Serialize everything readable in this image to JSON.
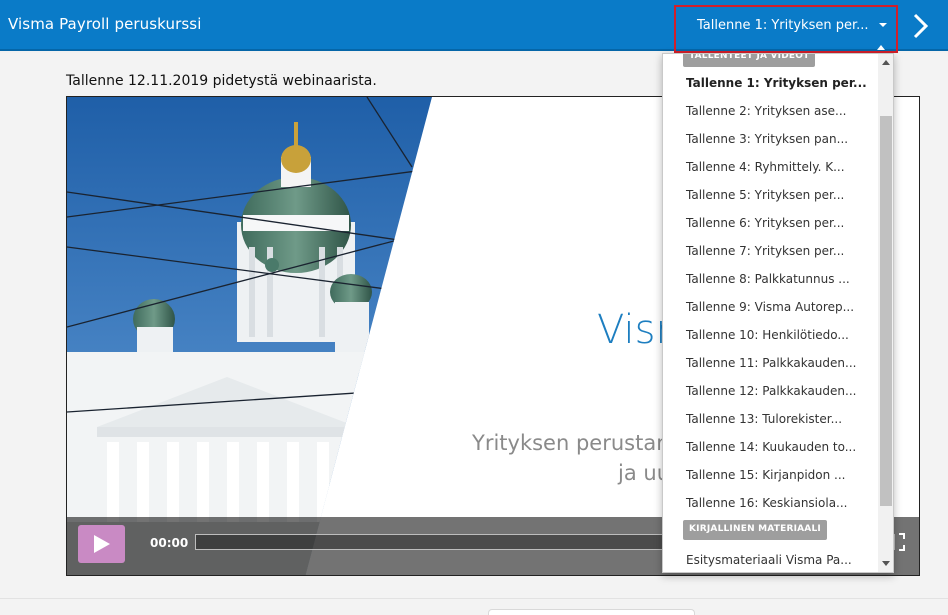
{
  "header": {
    "course_title": "Visma Payroll peruskurssi",
    "selected_recording": "Tallenne 1: Yrityksen per...",
    "next_icon": "chevron-right-icon",
    "bar_color": "#0a7bc8",
    "highlight_color": "#d21f2a"
  },
  "main": {
    "caption": "Tallenne 12.11.2019 pidetystä webinaarista.",
    "slide": {
      "title": "Visma",
      "subtitle_line1": "Yrityksen perustamin",
      "subtitle_line2": "ja uu"
    },
    "player": {
      "play_icon": "play-icon",
      "time": "00:00",
      "fullscreen_icon": "fullscreen-icon",
      "play_color": "#c98ac4"
    }
  },
  "dropdown": {
    "group1_label": "TALLENTEET JA VIDEOT",
    "items": [
      "Tallenne 1: Yrityksen per...",
      "Tallenne 2: Yrityksen ase...",
      "Tallenne 3: Yrityksen pan...",
      "Tallenne 4: Ryhmittely. K...",
      "Tallenne 5: Yrityksen per...",
      "Tallenne 6: Yrityksen per...",
      "Tallenne 7: Yrityksen per...",
      "Tallenne 8: Palkkatunnus ...",
      "Tallenne 9: Visma Autorep...",
      "Tallenne 10: Henkilötiedo...",
      "Tallenne 11: Palkkakauden...",
      "Tallenne 12: Palkkakauden...",
      "Tallenne 13: Tulorekister...",
      "Tallenne 14: Kuukauden to...",
      "Tallenne 15: Kirjanpidon ...",
      "Tallenne 16: Keskiansiola..."
    ],
    "group2_label": "KIRJALLINEN MATERIAALI",
    "material_item": "Esitysmateriaali Visma Pa..."
  }
}
